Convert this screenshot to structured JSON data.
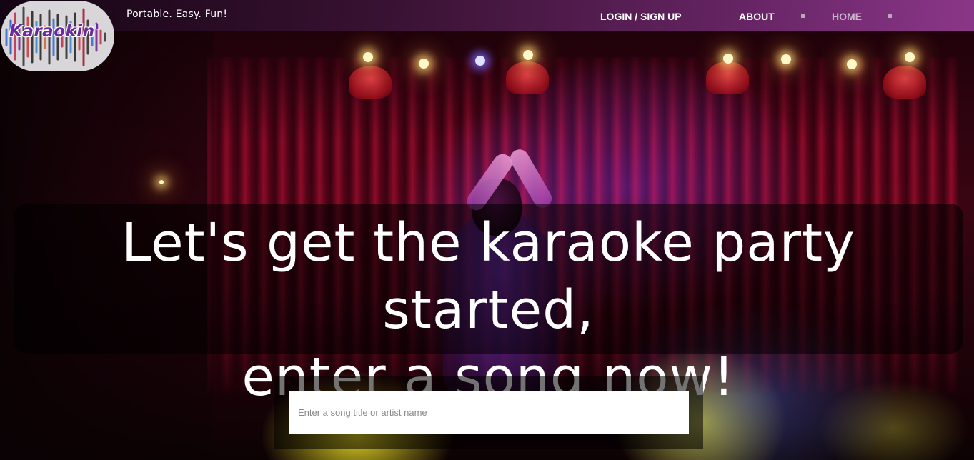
{
  "header": {
    "logo_text": "Karaokin'",
    "tagline": "Portable. Easy. Fun!",
    "nav": {
      "login": "LOGIN / SIGN UP",
      "about": "ABOUT",
      "home": "HOME"
    }
  },
  "hero": {
    "line1": "Let's get the karaoke party started,",
    "line2": "enter a song now!"
  },
  "search": {
    "placeholder": "Enter a song title or artist name",
    "value": ""
  },
  "colors": {
    "logo_text": "#6a2aa0",
    "nav_active": "#ffffff",
    "nav_muted": "#c9b8cc",
    "header_gradient_end": "#963c96"
  }
}
